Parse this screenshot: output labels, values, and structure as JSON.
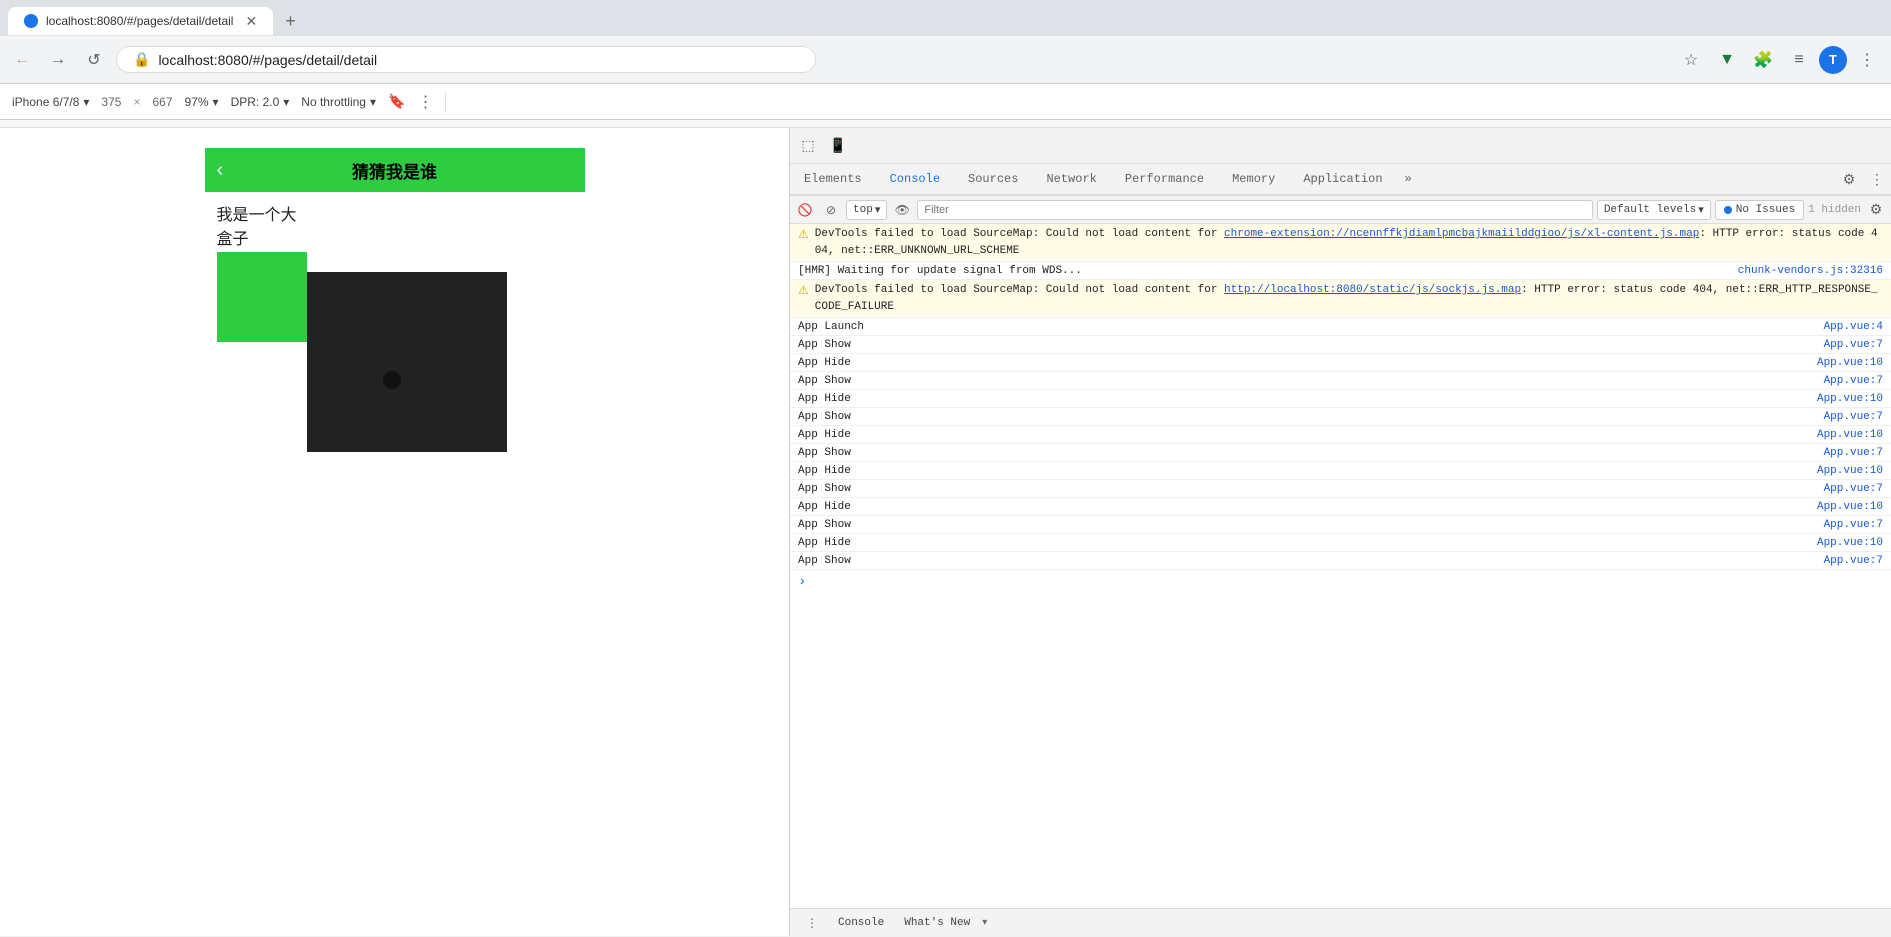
{
  "browser": {
    "tab_title": "localhost:8080/#/pages/detail/detail",
    "url": "localhost:8080/#/pages/detail/detail",
    "back_disabled": true,
    "forward_disabled": true
  },
  "device_toolbar": {
    "device": "iPhone 6/7/8",
    "width": "375",
    "height": "667",
    "zoom": "97%",
    "dpr": "DPR: 2.0",
    "throttle": "No throttling"
  },
  "mobile_page": {
    "title": "猜猜我是谁",
    "body_text": "我是一个大盒子"
  },
  "devtools": {
    "tabs": [
      "Elements",
      "Console",
      "Sources",
      "Network",
      "Performance",
      "Memory",
      "Application"
    ],
    "active_tab": "Console",
    "console_toolbar": {
      "context": "top",
      "filter_placeholder": "Filter",
      "level": "Default levels",
      "issues": "No Issues",
      "hidden": "1 hidden"
    },
    "messages": [
      {
        "type": "warning",
        "text_before": "DevTools failed to load SourceMap: Could not load content for ",
        "link": "chrome-extension://ncennffkjdiamlpmcbajkmaiilddgioo/js/xl-content.js.map",
        "text_after": ": HTTP error: status code 404, net::ERR_UNKNOWN_URL_SCHEME",
        "source": ""
      },
      {
        "type": "info",
        "text": "[HMR] Waiting for update signal from WDS...",
        "source": "chunk-vendors.js:32316"
      },
      {
        "type": "warning",
        "text_before": "DevTools failed to load SourceMap: Could not load content for ",
        "link": "http://localhost:8080/static/js/sockjs.js.map",
        "text_after": ": HTTP error: status code 404, net::ERR_HTTP_RESPONSE_CODE_FAILURE",
        "source": ""
      },
      {
        "type": "plain",
        "text": "App Launch",
        "source": "App.vue:4"
      },
      {
        "type": "plain",
        "text": "App Show",
        "source": "App.vue:7"
      },
      {
        "type": "plain",
        "text": "App Hide",
        "source": "App.vue:10"
      },
      {
        "type": "plain",
        "text": "App Show",
        "source": "App.vue:7"
      },
      {
        "type": "plain",
        "text": "App Hide",
        "source": "App.vue:10"
      },
      {
        "type": "plain",
        "text": "App Show",
        "source": "App.vue:7"
      },
      {
        "type": "plain",
        "text": "App Hide",
        "source": "App.vue:10"
      },
      {
        "type": "plain",
        "text": "App Show",
        "source": "App.vue:7"
      },
      {
        "type": "plain",
        "text": "App Hide",
        "source": "App.vue:10"
      },
      {
        "type": "plain",
        "text": "App Show",
        "source": "App.vue:7"
      },
      {
        "type": "plain",
        "text": "App Hide",
        "source": "App.vue:10"
      },
      {
        "type": "plain",
        "text": "App Show",
        "source": "App.vue:7"
      },
      {
        "type": "plain",
        "text": "App Hide",
        "source": "App.vue:10"
      },
      {
        "type": "plain",
        "text": "App Show",
        "source": "App.vue:7"
      }
    ]
  },
  "labels": {
    "back": "←",
    "forward": "→",
    "reload": "↺",
    "more": "⋮",
    "lock": "🔒",
    "star": "☆",
    "puzzle": "🧩",
    "download": "⬇",
    "profile": "👤",
    "three_dots": "⋮",
    "device_chevron": "▾",
    "throttle_chevron": "▾",
    "dpr_chevron": "▾",
    "zoom_chevron": "▾",
    "rotate_icon": "⟳",
    "bookmarks_icon": "≡",
    "dt_inspect": "⬚",
    "dt_device": "📱",
    "dt_ban": "🚫",
    "dt_eye": "👁",
    "dt_gear": "⚙",
    "console_arrow": "›",
    "filter_icon": "▾"
  }
}
